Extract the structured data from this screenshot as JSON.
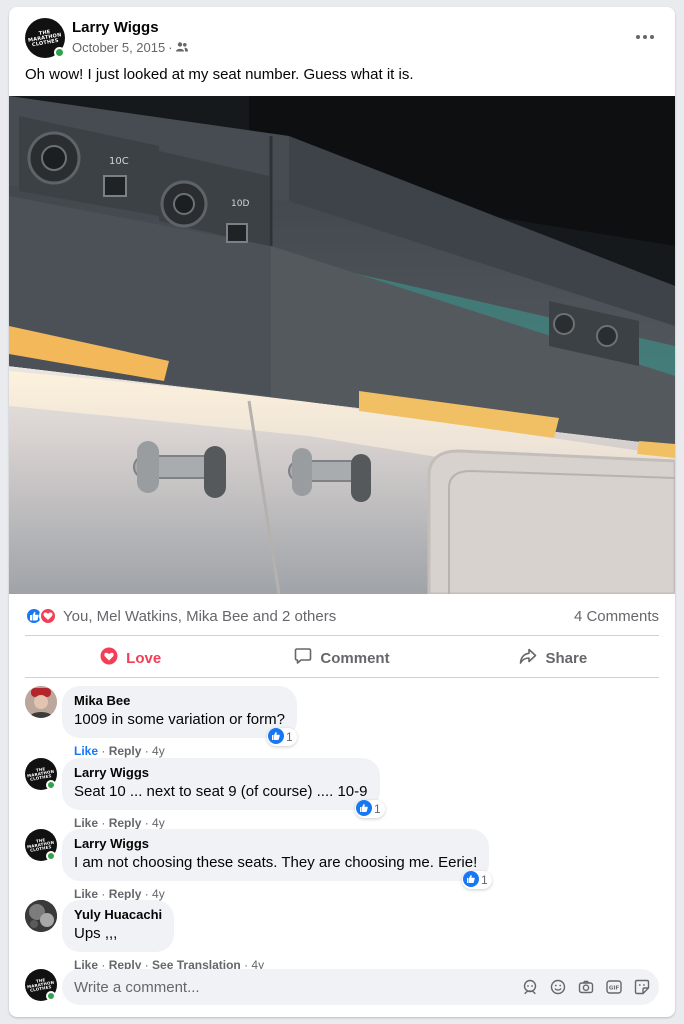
{
  "post": {
    "author": "Larry Wiggs",
    "date": "October 5, 2015",
    "audience_icon": "friends-icon",
    "text": "Oh wow! I just looked at my seat number. Guess what it is.",
    "photo_labels": {
      "seat_a": "10C",
      "seat_b": "10D"
    },
    "avatar_logo_lines": [
      "THE",
      "MARATHON",
      "CLOTHES"
    ]
  },
  "reactions": {
    "summary": "You, Mel Watkins, Mika Bee and 2 others",
    "comments_count": "4 Comments",
    "icons": [
      "like-reaction-icon",
      "love-reaction-icon"
    ]
  },
  "actions": {
    "love": "Love",
    "comment": "Comment",
    "share": "Share"
  },
  "comments": [
    {
      "name": "Mika Bee",
      "text": "1009 in some variation or form?",
      "like": "Like",
      "reply": "Reply",
      "time": "4y",
      "reaction_count": "1"
    },
    {
      "name": "Larry Wiggs",
      "text": "Seat 10 ... next to seat 9 (of course) .... 10-9",
      "like": "Like",
      "reply": "Reply",
      "time": "4y",
      "reaction_count": "1"
    },
    {
      "name": "Larry Wiggs",
      "text": "I am not choosing these seats. They are choosing me. Eerie!",
      "like": "Like",
      "reply": "Reply",
      "time": "4y",
      "reaction_count": "1"
    },
    {
      "name": "Yuly Huacachi",
      "text": "Ups ,,,",
      "like": "Like",
      "reply": "Reply",
      "see_translation": "See Translation",
      "time": "4y"
    }
  ],
  "composer": {
    "placeholder": "Write a comment...",
    "icons": [
      "avatar-sticker-icon",
      "emoji-icon",
      "camera-icon",
      "gif-icon",
      "sticker-icon"
    ]
  },
  "colors": {
    "accent_blue": "#1877f2",
    "love_red": "#f33e58",
    "online_green": "#31a24c"
  }
}
